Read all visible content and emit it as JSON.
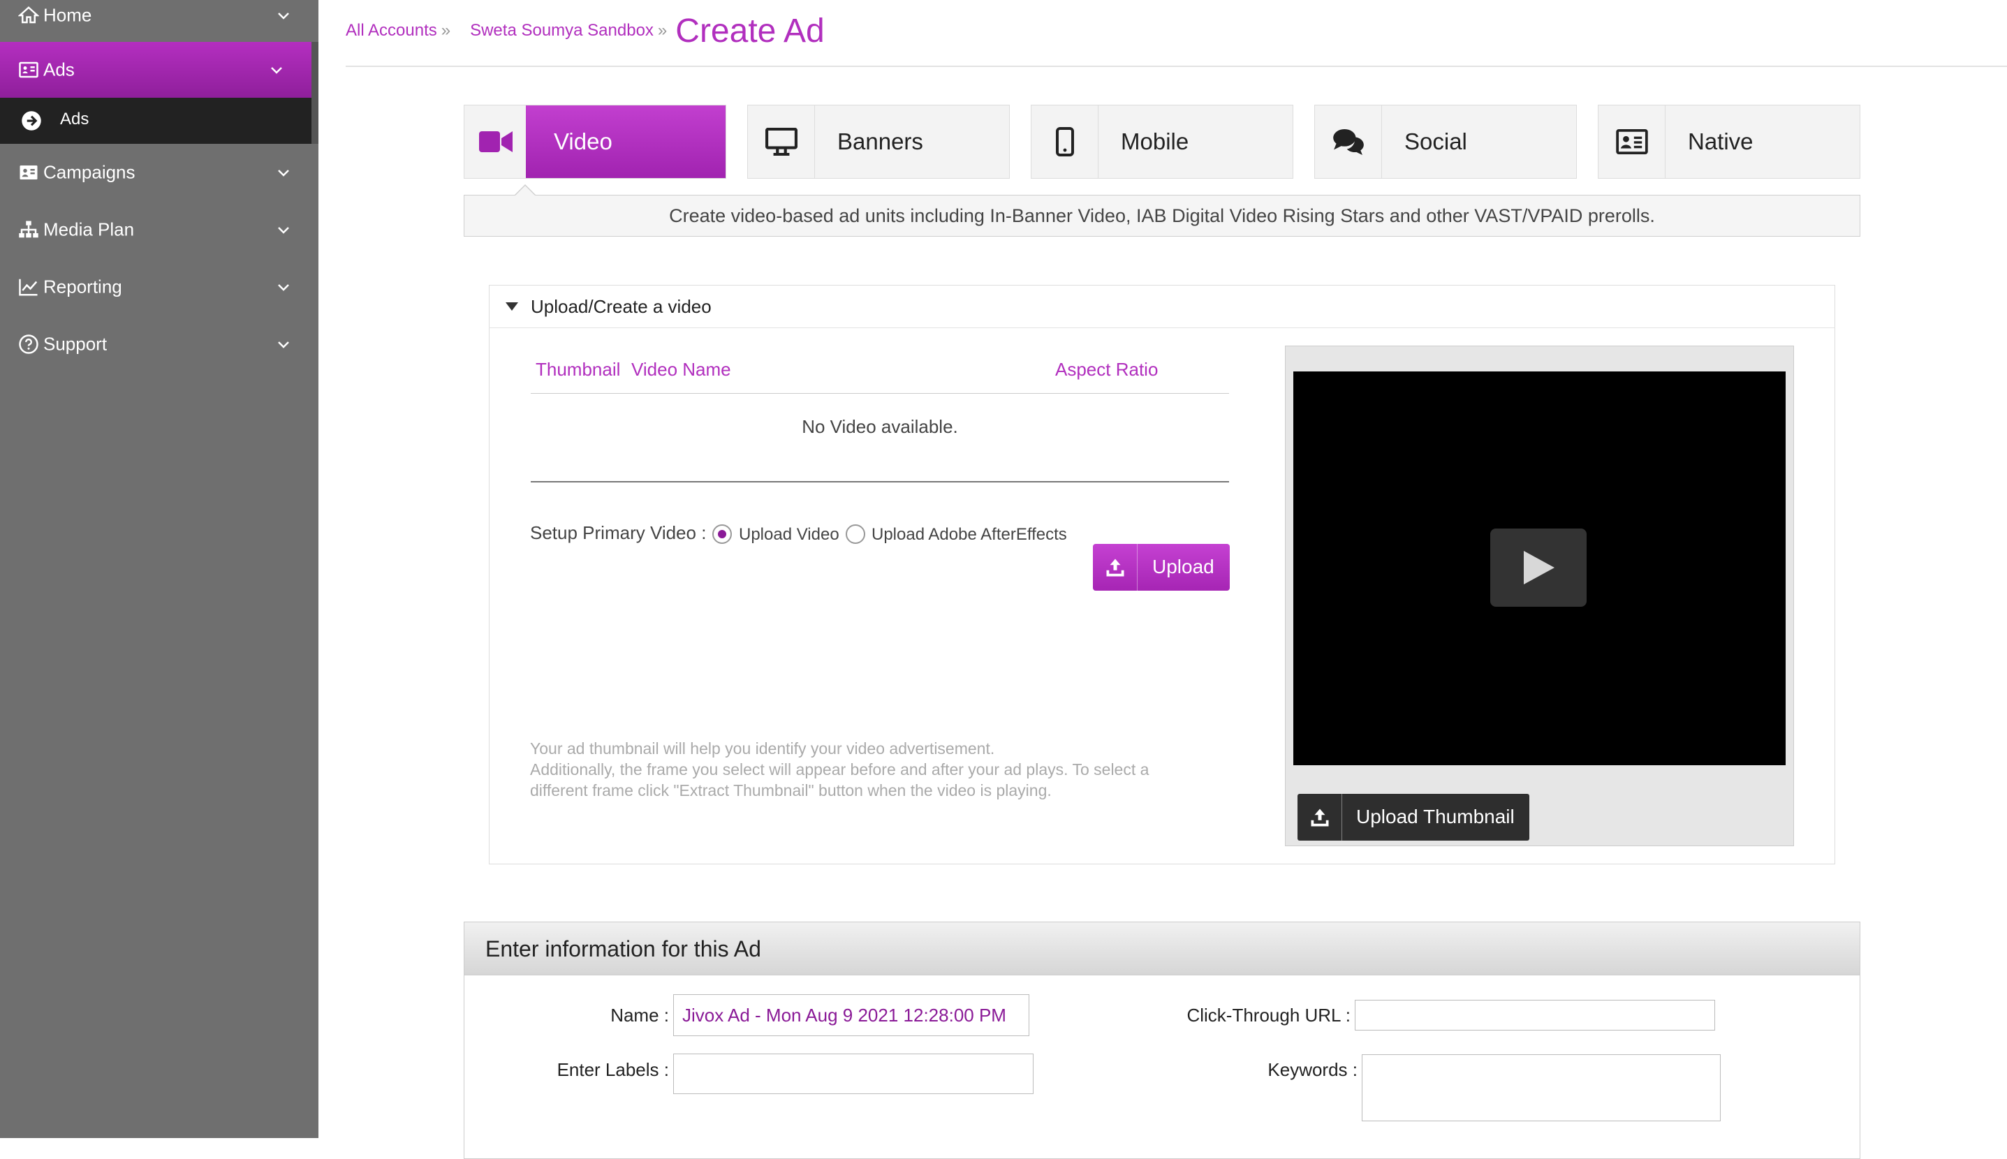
{
  "sidebar": {
    "items": [
      {
        "label": "Home",
        "icon": "home-icon"
      },
      {
        "label": "Ads",
        "icon": "id-card-icon",
        "active": true
      },
      {
        "label": "Campaigns",
        "icon": "id-card-icon"
      },
      {
        "label": "Media Plan",
        "icon": "sitemap-icon"
      },
      {
        "label": "Reporting",
        "icon": "line-chart-icon"
      },
      {
        "label": "Support",
        "icon": "question-circle-icon"
      }
    ],
    "subitem": {
      "label": "Ads",
      "icon": "arrow-circle-right-icon"
    }
  },
  "breadcrumb": {
    "items": [
      "All Accounts",
      "Sweta Soumya Sandbox"
    ],
    "separator": "»",
    "title": "Create Ad"
  },
  "tabs": [
    {
      "label": "Video",
      "icon": "video-camera-icon",
      "active": true
    },
    {
      "label": "Banners",
      "icon": "monitor-icon"
    },
    {
      "label": "Mobile",
      "icon": "mobile-icon"
    },
    {
      "label": "Social",
      "icon": "comments-icon"
    },
    {
      "label": "Native",
      "icon": "id-card-icon"
    }
  ],
  "tab_description": "Create video-based ad units including In-Banner Video, IAB Digital Video Rising Stars and other VAST/VPAID prerolls.",
  "upload_panel": {
    "title": "Upload/Create a video",
    "columns": [
      "Thumbnail",
      "Video Name",
      "Aspect Ratio"
    ],
    "empty_text": "No Video available.",
    "setup_label": "Setup Primary Video :",
    "radio_options": [
      {
        "label": "Upload Video",
        "checked": true
      },
      {
        "label": "Upload Adobe AfterEffects",
        "checked": false
      }
    ],
    "upload_label": "Upload",
    "help_lines": [
      "Your ad thumbnail will help you identify your video advertisement.",
      "Additionally, the frame you select will appear before and after your ad plays. To select a",
      "different frame click \"Extract Thumbnail\" button when the video is playing."
    ],
    "upload_thumbnail_label": "Upload Thumbnail"
  },
  "info_section": {
    "title": "Enter information for this Ad",
    "name_label": "Name :",
    "name_value": "Jivox Ad - Mon Aug 9 2021 12:28:00 PM",
    "labels_label": "Enter Labels :",
    "labels_value": "",
    "click_url_label": "Click-Through URL :",
    "click_url_value": "",
    "keywords_label": "Keywords :",
    "keywords_value": ""
  },
  "colors": {
    "accent": "#b12fbe",
    "sidebar": "#6f6f6f",
    "sidebar_dark": "#222222"
  }
}
